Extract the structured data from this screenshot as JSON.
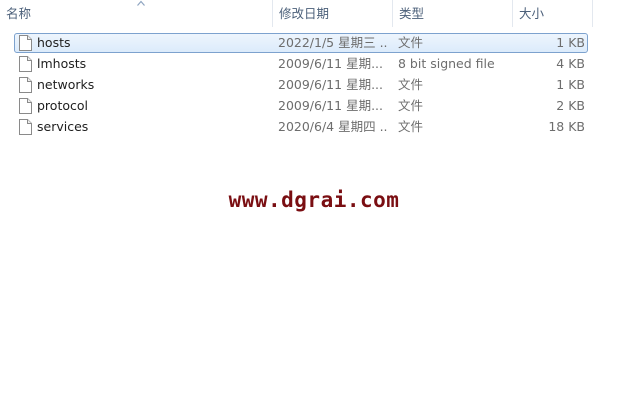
{
  "columns": {
    "name": "名称",
    "date": "修改日期",
    "type": "类型",
    "size": "大小"
  },
  "files": [
    {
      "name": "hosts",
      "date": "2022/1/5 星期三 ...",
      "type": "文件",
      "size": "1 KB",
      "selected": true
    },
    {
      "name": "lmhosts",
      "date": "2009/6/11 星期...",
      "type": "8 bit signed file",
      "size": "4 KB",
      "selected": false
    },
    {
      "name": "networks",
      "date": "2009/6/11 星期...",
      "type": "文件",
      "size": "1 KB",
      "selected": false
    },
    {
      "name": "protocol",
      "date": "2009/6/11 星期...",
      "type": "文件",
      "size": "2 KB",
      "selected": false
    },
    {
      "name": "services",
      "date": "2020/6/4 星期四 ...",
      "type": "文件",
      "size": "18 KB",
      "selected": false
    }
  ],
  "icons": {
    "file": "file-icon",
    "sort": "sort-up-arrow-icon"
  },
  "colors": {
    "header_text": "#4c607a",
    "selection_border": "#7da2ce",
    "watermark": "#7a0e12"
  },
  "watermark": "www.dgrai.com"
}
